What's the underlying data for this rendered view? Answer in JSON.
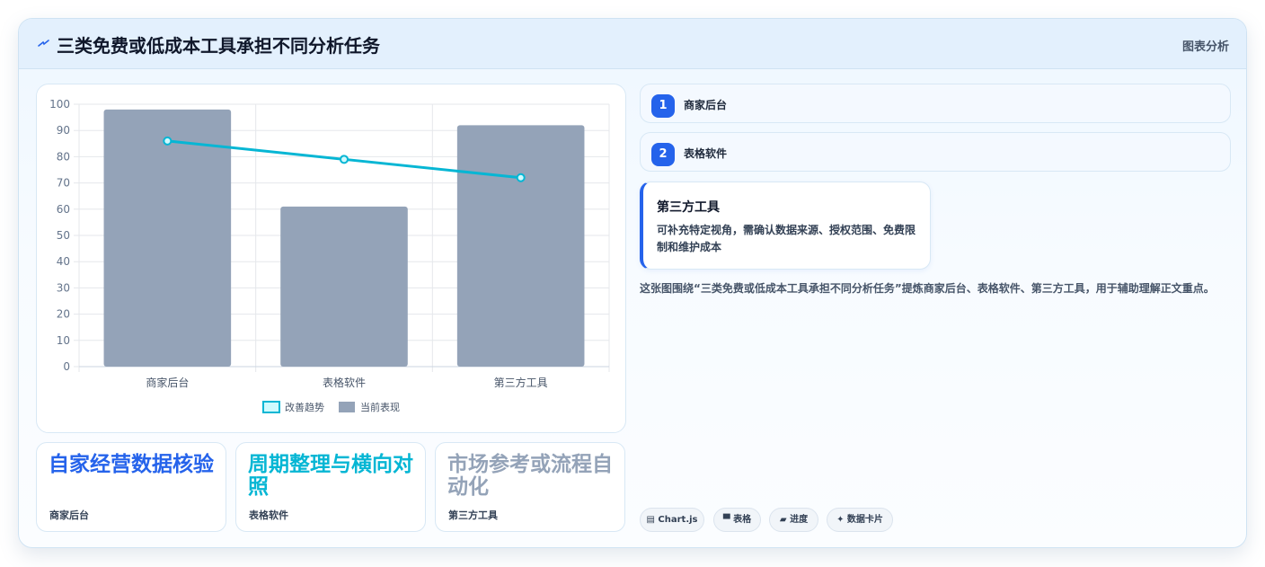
{
  "header": {
    "icon": "chart-spark-icon",
    "title": "三类免费或低成本工具承担不同分析任务",
    "tag": "图表分析"
  },
  "chart_data": {
    "type": "bar",
    "categories": [
      "商家后台",
      "表格软件",
      "第三方工具"
    ],
    "series": [
      {
        "name": "改善趋势",
        "type": "line",
        "color": "#06b6d4",
        "values": [
          86,
          79,
          72
        ]
      },
      {
        "name": "当前表现",
        "type": "bar",
        "color": "#94a3b8",
        "values": [
          98,
          61,
          92
        ]
      }
    ],
    "ylim": [
      0,
      100
    ],
    "yticks": [
      0,
      10,
      20,
      30,
      40,
      50,
      60,
      70,
      80,
      90,
      100
    ],
    "grid": true,
    "legend": "bottom"
  },
  "kpis": [
    {
      "title": "自家经营数据核验",
      "sub": "商家后台",
      "color": "#2563eb"
    },
    {
      "title": "周期整理与横向对照",
      "sub": "表格软件",
      "color": "#06b6d4"
    },
    {
      "title": "市场参考或流程自动化",
      "sub": "第三方工具",
      "color": "#94a3b8"
    }
  ],
  "steps": [
    {
      "num": "1",
      "label": "商家后台"
    },
    {
      "num": "2",
      "label": "表格软件"
    }
  ],
  "detail": {
    "title": "第三方工具",
    "text": "可补充特定视角，需确认数据来源、授权范围、免费限制和维护成本"
  },
  "summary": "这张图围绕“三类免费或低成本工具承担不同分析任务”提炼商家后台、表格软件、第三方工具，用于辅助理解正文重点。",
  "tools": [
    {
      "label": "▤ Chart.js"
    },
    {
      "label": "▀ 表格"
    },
    {
      "label": "▰ 进度"
    },
    {
      "label": "✦ 数据卡片"
    }
  ]
}
